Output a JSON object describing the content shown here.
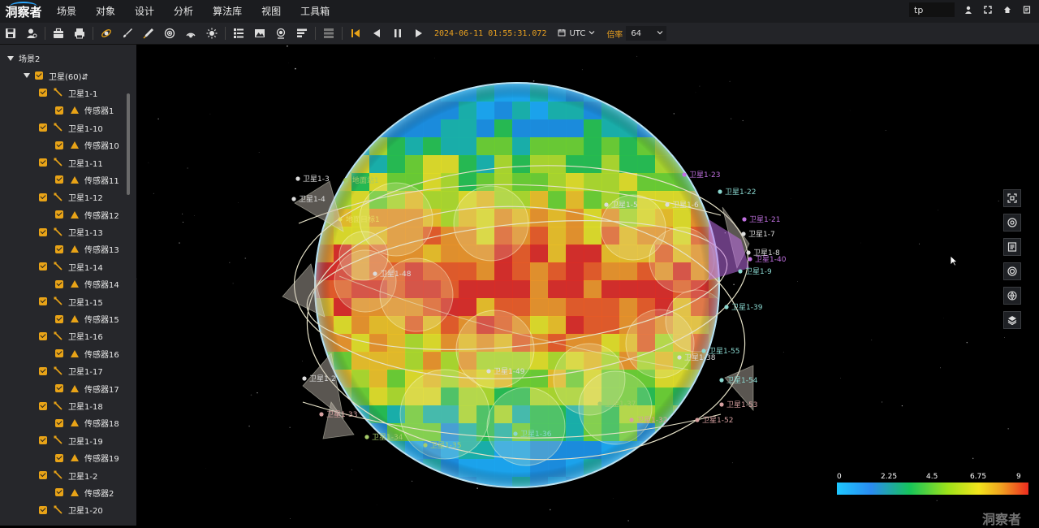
{
  "app": {
    "logo_text": "洞察者",
    "watermark": "洞察者"
  },
  "menu": [
    "场景",
    "对象",
    "设计",
    "分析",
    "算法库",
    "视图",
    "工具箱"
  ],
  "user": {
    "value": "tp"
  },
  "toolbar": {
    "time": "2024-06-11 01:55:31.072",
    "timezone": "UTC",
    "rate_label": "倍率",
    "rate_value": "64"
  },
  "tree": {
    "root": "场景2",
    "group": "卫星(60)⇵",
    "items": [
      {
        "sat": "卫星1-1",
        "sensor": "传感器1"
      },
      {
        "sat": "卫星1-10",
        "sensor": "传感器10"
      },
      {
        "sat": "卫星1-11",
        "sensor": "传感器11"
      },
      {
        "sat": "卫星1-12",
        "sensor": "传感器12"
      },
      {
        "sat": "卫星1-13",
        "sensor": "传感器13"
      },
      {
        "sat": "卫星1-14",
        "sensor": "传感器14"
      },
      {
        "sat": "卫星1-15",
        "sensor": "传感器15"
      },
      {
        "sat": "卫星1-16",
        "sensor": "传感器16"
      },
      {
        "sat": "卫星1-17",
        "sensor": "传感器17"
      },
      {
        "sat": "卫星1-18",
        "sensor": "传感器18"
      },
      {
        "sat": "卫星1-19",
        "sensor": "传感器19"
      },
      {
        "sat": "卫星1-2",
        "sensor": "传感器2"
      },
      {
        "sat": "卫星1-20",
        "sensor": ""
      }
    ]
  },
  "globe_labels": {
    "ground_station": "地面站1",
    "ground_target": "地面目标1",
    "sats": [
      "卫星1-23",
      "卫星1-22",
      "卫星1-21",
      "卫星1-7",
      "卫星1-8",
      "卫星1-40",
      "卫星1-9",
      "卫星1-39",
      "卫星1-55",
      "卫星1-54",
      "卫星1-53",
      "卫星1-52",
      "卫星1-36",
      "卫星1-35",
      "卫星1-34",
      "卫星1-33",
      "卫星1-37",
      "卫星1-32",
      "卫星1-6",
      "卫星1-5",
      "卫星1-4",
      "卫星1-3",
      "卫星1-2",
      "卫星1-49",
      "卫星1-48",
      "卫星1-38"
    ]
  },
  "legend": {
    "ticks": [
      "0",
      "2.25",
      "4.5",
      "6.75",
      "9"
    ],
    "min": 0,
    "max": 9
  },
  "colors": {
    "accent": "#e8a317",
    "time": "#e8a020",
    "orbit": "#e6e2c8"
  }
}
